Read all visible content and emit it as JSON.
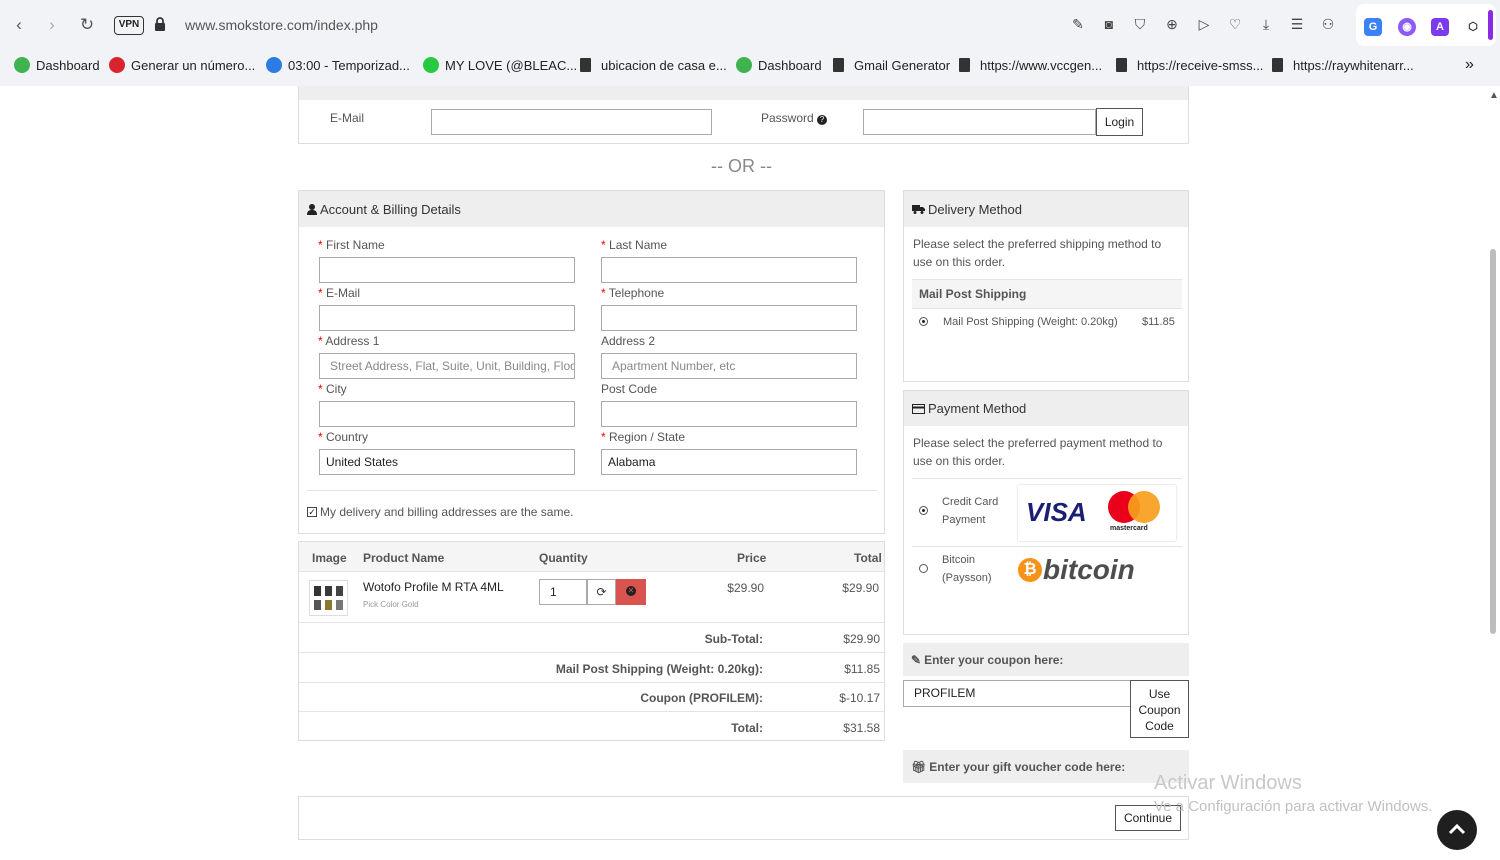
{
  "browser": {
    "url": "www.smokstore.com/index.php",
    "vpn": "VPN"
  },
  "bookmarks": [
    {
      "label": "Dashboard",
      "color": "#3fb34f"
    },
    {
      "label": "Generar un número...",
      "color": "#d9232d"
    },
    {
      "label": "03:00 - Temporizad...",
      "color": "#2d7be5"
    },
    {
      "label": "MY LOVE (@BLEAC...",
      "color": "#27c93f"
    },
    {
      "label": "ubicacion de casa e...",
      "color": "#333333"
    },
    {
      "label": "Dashboard",
      "color": "#3fb34f"
    },
    {
      "label": "Gmail Generator",
      "color": "#333333"
    },
    {
      "label": "https://www.vccgen...",
      "color": "#333333"
    },
    {
      "label": "https://receive-smss...",
      "color": "#333333"
    },
    {
      "label": "https://raywhitenarr...",
      "color": "#333333"
    }
  ],
  "login": {
    "email_label": "E-Mail",
    "password_label": "Password",
    "login_button": "Login"
  },
  "or_text": "-- OR --",
  "billing": {
    "title": "Account & Billing Details",
    "first_name": "First Name",
    "last_name": "Last Name",
    "email": "E-Mail",
    "telephone": "Telephone",
    "address1": "Address 1",
    "address2": "Address 2",
    "address1_placeholder": "Street Address, Flat, Suite, Unit, Building, Floor,",
    "address2_placeholder": "Apartment Number, etc",
    "city": "City",
    "postcode": "Post Code",
    "country": "Country",
    "region": "Region / State",
    "country_value": "United States",
    "region_value": "Alabama",
    "same_address": "My delivery and billing addresses are the same.",
    "required_mark": "*"
  },
  "cart": {
    "headers": {
      "image": "Image",
      "name": "Product Name",
      "qty": "Quantity",
      "price": "Price",
      "total": "Total"
    },
    "item": {
      "name": "Wotofo Profile M RTA 4ML",
      "option": "Pick Color Gold",
      "qty": "1",
      "price": "$29.90",
      "total": "$29.90"
    },
    "totals": [
      {
        "label": "Sub-Total:",
        "value": "$29.90"
      },
      {
        "label": "Mail Post Shipping (Weight: 0.20kg):",
        "value": "$11.85"
      },
      {
        "label": "Coupon (PROFILEM):",
        "value": "$-10.17"
      },
      {
        "label": "Total:",
        "value": "$31.58"
      }
    ]
  },
  "delivery": {
    "title": "Delivery Method",
    "desc": "Please select the preferred shipping method to use on this order.",
    "group": "Mail Post Shipping",
    "option": "Mail Post Shipping (Weight: 0.20kg)",
    "price": "$11.85"
  },
  "payment": {
    "title": "Payment Method",
    "desc": "Please select the preferred payment method to use on this order.",
    "card_label": "Credit Card Payment",
    "bitcoin_label": "Bitcoin (Paysson)",
    "visa": "VISA",
    "mastercard": "mastercard",
    "bitcoin_logo": "bitcoin"
  },
  "coupon": {
    "title": "Enter your coupon here:",
    "value": "PROFILEM",
    "button": "Use Coupon Code"
  },
  "voucher": {
    "title": "Enter your gift voucher code here:"
  },
  "continue_button": "Continue",
  "watermark": {
    "line1": "Activar Windows",
    "line2": "Ve a Configuración para activar Windows."
  }
}
